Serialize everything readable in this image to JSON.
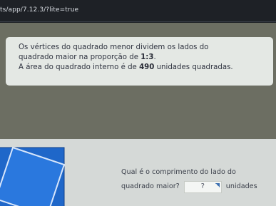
{
  "browser": {
    "url": "ts/app/7.12.3/?lite=true"
  },
  "problem": {
    "line1": "Os vértices do quadrado menor dividem os lados do",
    "line2_prefix": "quadrado maior na proporção de ",
    "ratio": "1:3",
    "line2_suffix": ".",
    "line3_prefix": "A área do quadrado interno é de ",
    "area": "490",
    "line3_suffix": " unidades quadradas."
  },
  "question": {
    "line1": "Qual é o comprimento do lado do",
    "line2_prefix": "quadrado maior?",
    "answer_value": "?",
    "unit": "unidades"
  },
  "figure": {
    "outer_color": "#1f67c9",
    "inner_color": "#2a78de",
    "stroke_color": "#0f3f8a"
  }
}
